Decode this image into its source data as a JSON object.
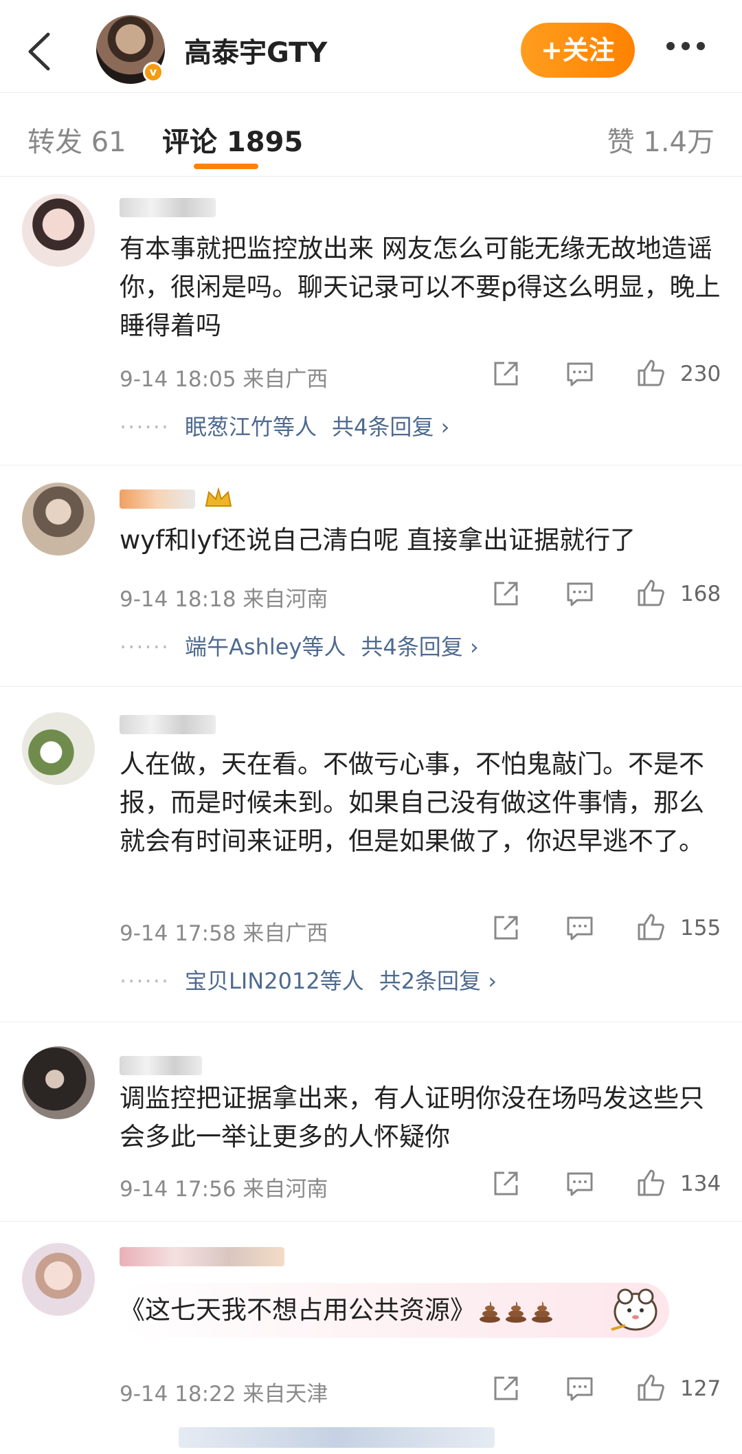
{
  "header": {
    "account_name": "高泰宇GTY",
    "verify_mark": "v",
    "follow_label": "+关注"
  },
  "tabs": {
    "repost": "转发 61",
    "comments": "评论 1895",
    "likes": "赞 1.4万"
  },
  "colors": {
    "accent": "#ff8200",
    "link": "#4f6a8f"
  },
  "comments": [
    {
      "text": "有本事就把监控放出来 网友怎么可能无缘无故地造谣你，很闲是吗。聊天记录可以不要p得这么明显，晚上睡得着吗",
      "time": "9-14 18:05",
      "location": "来自广西",
      "likes": "230",
      "reply_by": "眠葱江竹等人",
      "reply_count": "共4条回复 ›"
    },
    {
      "text": "wyf和lyf还说自己清白呢 直接拿出证据就行了",
      "time": "9-14 18:18",
      "location": "来自河南",
      "likes": "168",
      "reply_by": "端午Ashley等人",
      "reply_count": "共4条回复 ›"
    },
    {
      "text": "人在做，天在看。不做亏心事，不怕鬼敲门。不是不报，而是时候未到。如果自己没有做这件事情，那么就会有时间来证明，但是如果做了，你迟早逃不了。",
      "time": "9-14 17:58",
      "location": "来自广西",
      "likes": "155",
      "reply_by": "宝贝LIN2012等人",
      "reply_count": "共2条回复 ›"
    },
    {
      "text": "调监控把证据拿出来，有人证明你没在场吗发这些只会多此一举让更多的人怀疑你",
      "time": "9-14 17:56",
      "location": "来自河南",
      "likes": "134"
    },
    {
      "text": "《这七天我不想占用公共资源》",
      "time": "9-14 18:22",
      "location": "来自天津",
      "likes": "127"
    }
  ]
}
